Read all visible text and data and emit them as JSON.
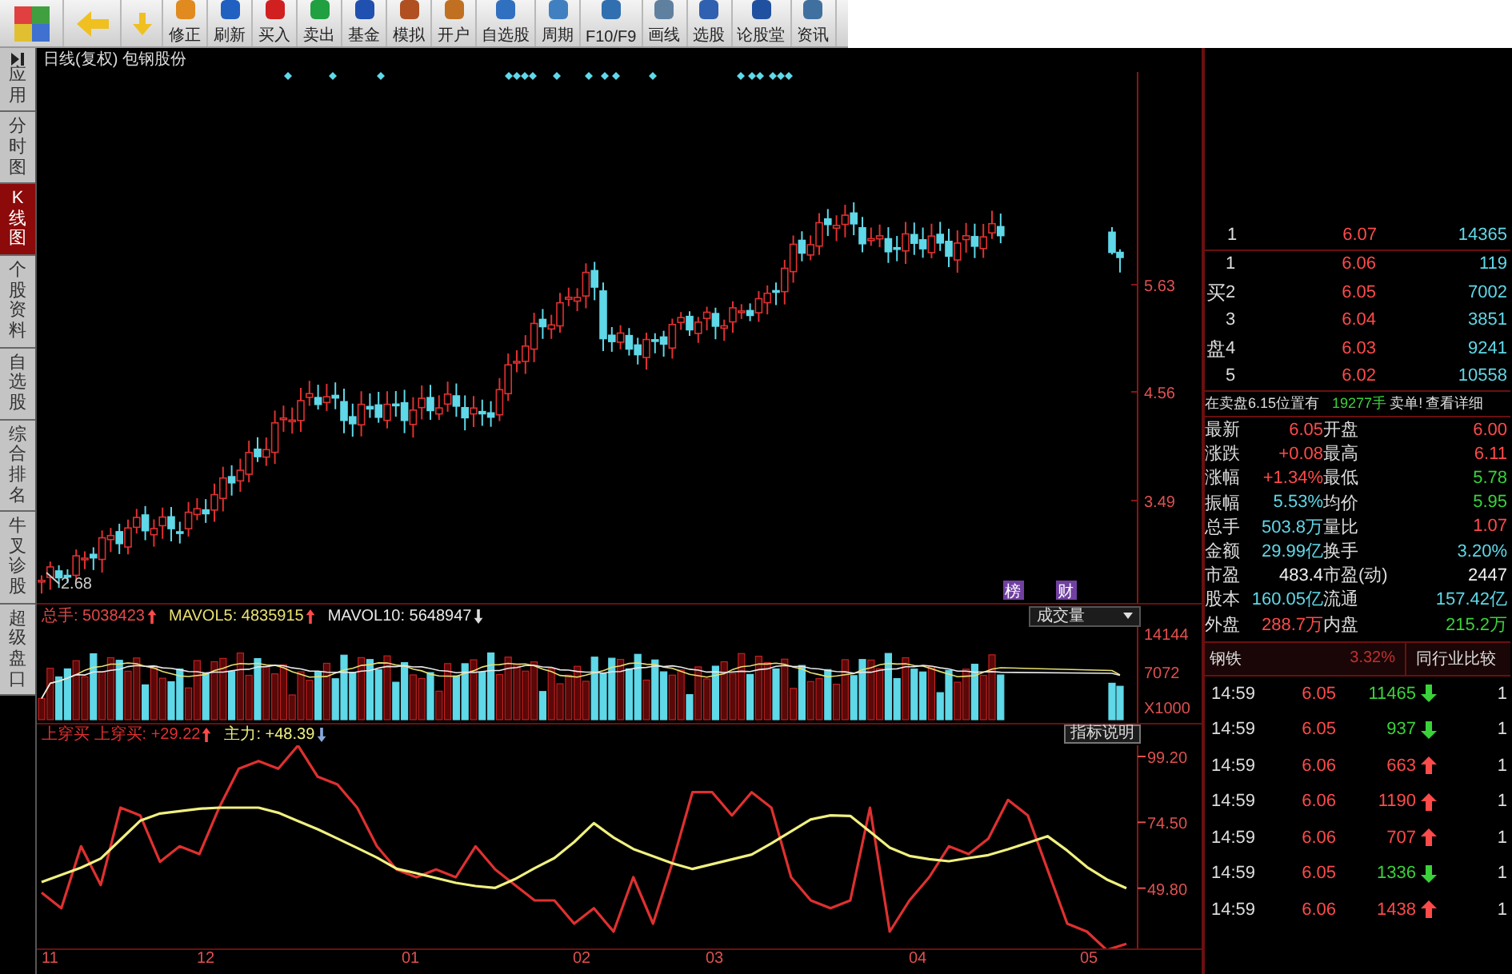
{
  "toolbar": {
    "buttons": [
      {
        "label": "修正"
      },
      {
        "label": "刷新"
      },
      {
        "label": "买入"
      },
      {
        "label": "卖出"
      },
      {
        "label": "基金"
      },
      {
        "label": "模拟"
      },
      {
        "label": "开户"
      },
      {
        "label": "自选股"
      },
      {
        "label": "周期"
      },
      {
        "label": "F10/F9"
      },
      {
        "label": "画线"
      },
      {
        "label": "选股"
      },
      {
        "label": "论股堂"
      },
      {
        "label": "资讯"
      }
    ]
  },
  "sidebar": {
    "tabs": [
      {
        "label": "应用",
        "selected": false
      },
      {
        "label": "分时图",
        "selected": false
      },
      {
        "label": "K线图",
        "selected": true
      },
      {
        "label": "个股资料",
        "selected": false
      },
      {
        "label": "自选股",
        "selected": false
      },
      {
        "label": "综合排名",
        "selected": false
      },
      {
        "label": "牛叉诊股",
        "selected": false
      },
      {
        "label": "超级盘口",
        "selected": false
      }
    ]
  },
  "chart": {
    "title": "日线(复权) 包钢股份",
    "price_axis": [
      "5.63",
      "4.56",
      "3.49"
    ],
    "low_label": "2.68",
    "event_tags": [
      "榜",
      "财"
    ]
  },
  "volume": {
    "legend": [
      {
        "label": "总手: 5038423",
        "rising": true,
        "color": "#e04848"
      },
      {
        "label": "MAVOL5: 4835915",
        "rising": true,
        "color": "#e8e070"
      },
      {
        "label": "MAVOL10: 5648947",
        "rising": false,
        "color": "#e8e8e8"
      }
    ],
    "selector": "成交量",
    "axis": [
      "14144",
      "7072",
      "X1000"
    ]
  },
  "indicator": {
    "legend": [
      {
        "label": "上穿买 上穿买: +29.22",
        "rising": true,
        "color": "#e03030"
      },
      {
        "label": "主力: +48.39",
        "rising": false,
        "color": "#f0f080"
      }
    ],
    "help_button": "指标说明",
    "chart_data": {
      "type": "line",
      "ylim": [
        26.6,
        103.4
      ],
      "yticks": [
        {
          "value": 99.2,
          "label": "99.20"
        },
        {
          "value": 74.5,
          "label": "74.50"
        },
        {
          "value": 49.8,
          "label": "49.80"
        }
      ],
      "series": [
        {
          "color": "#e03030",
          "values": [
            48.1,
            42.3,
            65.5,
            51.0,
            80.0,
            77.1,
            59.7,
            65.5,
            62.6,
            80.0,
            94.6,
            97.5,
            94.6,
            103.3,
            91.6,
            88.7,
            80.0,
            65.5,
            56.8,
            53.9,
            56.8,
            53.9,
            65.5,
            56.8,
            51.0,
            45.2,
            45.2,
            36.5,
            42.3,
            33.5,
            53.9,
            36.5,
            59.7,
            85.8,
            85.8,
            77.1,
            85.8,
            80.0,
            53.9,
            45.2,
            42.3,
            45.2,
            80.0,
            33.5,
            45.2,
            53.9,
            65.5,
            62.6,
            68.4,
            82.9,
            77.1,
            56.8,
            36.5,
            33.5,
            26.6,
            28.9
          ]
        },
        {
          "color": "#f0f080",
          "values": [
            52.1,
            54.8,
            57.5,
            60.9,
            68.0,
            75.1,
            77.8,
            78.7,
            79.6,
            80.0,
            80.0,
            80.0,
            78.1,
            75.0,
            71.9,
            68.4,
            64.9,
            61.3,
            57.1,
            55.4,
            53.6,
            51.8,
            50.6,
            49.9,
            53.2,
            57.3,
            61.1,
            67.1,
            74.2,
            68.8,
            64.5,
            61.8,
            59.1,
            57.0,
            58.8,
            60.6,
            62.4,
            66.6,
            71.1,
            75.6,
            77.1,
            76.9,
            71.0,
            65.0,
            61.9,
            60.7,
            59.9,
            61.1,
            62.2,
            64.4,
            66.8,
            69.3,
            63.9,
            57.7,
            53.1,
            49.8
          ]
        }
      ]
    }
  },
  "x_axis": [
    "11",
    "12",
    "01",
    "02",
    "03",
    "04",
    "05"
  ],
  "quote": {
    "sell": [
      {
        "level": "1",
        "price": "6.07",
        "volume": "14365"
      }
    ],
    "buy_label": "买盘",
    "buy": [
      {
        "level": "1",
        "price": "6.06",
        "volume": "119"
      },
      {
        "level": "2",
        "price": "6.05",
        "volume": "7002"
      },
      {
        "level": "3",
        "price": "6.04",
        "volume": "3851"
      },
      {
        "level": "4",
        "price": "6.03",
        "volume": "9241"
      },
      {
        "level": "5",
        "price": "6.02",
        "volume": "10558"
      }
    ],
    "notice": {
      "prefix": "在卖盘6.15位置有",
      "amount": "19277手",
      "suffix": "卖单!",
      "link": "查看详细"
    },
    "stats": [
      [
        {
          "label": "最新",
          "value": "6.05",
          "color": "#ff4a4a"
        },
        {
          "label": "开盘",
          "value": "6.00",
          "color": "#ff4a4a"
        }
      ],
      [
        {
          "label": "涨跌",
          "value": "+0.08",
          "color": "#ff4a4a"
        },
        {
          "label": "最高",
          "value": "6.11",
          "color": "#ff4a4a"
        }
      ],
      [
        {
          "label": "涨幅",
          "value": "+1.34%",
          "color": "#ff4a4a"
        },
        {
          "label": "最低",
          "value": "5.78",
          "color": "#3ad23a"
        }
      ],
      [
        {
          "label": "振幅",
          "value": "5.53%",
          "color": "#5fd8e8"
        },
        {
          "label": "均价",
          "value": "5.95",
          "color": "#3ad23a"
        }
      ],
      [
        {
          "label": "总手",
          "value": "503.8万",
          "color": "#5fd8e8"
        },
        {
          "label": "量比",
          "value": "1.07",
          "color": "#ff4a4a"
        }
      ],
      [
        {
          "label": "金额",
          "value": "29.99亿",
          "color": "#5fd8e8"
        },
        {
          "label": "换手",
          "value": "3.20%",
          "color": "#5fd8e8"
        }
      ],
      [
        {
          "label": "市盈",
          "value": "483.4",
          "color": "#f0f0f0"
        },
        {
          "label": "市盈(动)",
          "value": "2447",
          "color": "#f0f0f0"
        }
      ],
      [
        {
          "label": "股本",
          "value": "160.05亿",
          "color": "#5fd8e8"
        },
        {
          "label": "流通",
          "value": "157.42亿",
          "color": "#5fd8e8"
        }
      ],
      [
        {
          "label": "外盘",
          "value": "288.7万",
          "color": "#ff4a4a"
        },
        {
          "label": "内盘",
          "value": "215.2万",
          "color": "#3ad23a"
        }
      ]
    ],
    "industry": {
      "name": "钢铁",
      "change": "3.32%",
      "compare": "同行业比较"
    },
    "ticks": [
      {
        "time": "14:59",
        "price": "6.05",
        "volume": "11465",
        "rising": false,
        "count": "1"
      },
      {
        "time": "14:59",
        "price": "6.05",
        "volume": "937",
        "rising": false,
        "count": "1"
      },
      {
        "time": "14:59",
        "price": "6.06",
        "volume": "663",
        "rising": true,
        "count": "1"
      },
      {
        "time": "14:59",
        "price": "6.06",
        "volume": "1190",
        "rising": true,
        "count": "1"
      },
      {
        "time": "14:59",
        "price": "6.06",
        "volume": "707",
        "rising": true,
        "count": "1"
      },
      {
        "time": "14:59",
        "price": "6.05",
        "volume": "1336",
        "rising": false,
        "count": "1"
      },
      {
        "time": "14:59",
        "price": "6.06",
        "volume": "1438",
        "rising": true,
        "count": "1"
      }
    ]
  }
}
